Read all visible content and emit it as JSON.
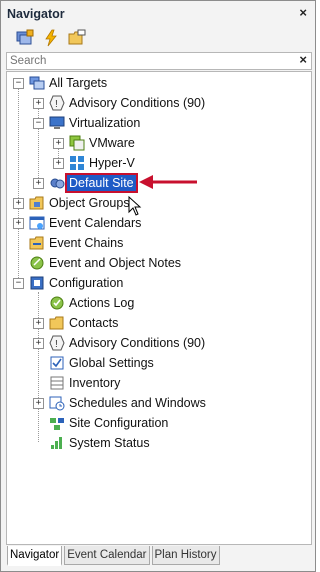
{
  "panel": {
    "title": "Navigator",
    "close_glyph": "×"
  },
  "toolbar": {
    "buttons": [
      "add-targets-icon",
      "lightning-icon",
      "folder-edit-icon"
    ]
  },
  "search": {
    "placeholder": "Search",
    "clear_glyph": "×"
  },
  "tree": {
    "all_targets": "All Targets",
    "advisory_conditions": "Advisory Conditions (90)",
    "virtualization": "Virtualization",
    "vmware": "VMware",
    "hyperv": "Hyper-V",
    "default_site": "Default Site",
    "object_groups": "Object Groups",
    "event_calendars": "Event Calendars",
    "event_chains": "Event Chains",
    "event_notes": "Event and Object Notes",
    "configuration": "Configuration",
    "actions_log": "Actions Log",
    "contacts": "Contacts",
    "config_advisory": "Advisory Conditions (90)",
    "global_settings": "Global Settings",
    "inventory": "Inventory",
    "schedules": "Schedules and Windows",
    "site_configuration": "Site Configuration",
    "system_status": "System Status"
  },
  "tabs": [
    "Navigator",
    "Event Calendar",
    "Plan History"
  ],
  "colors": {
    "selection": "#1e5bc6",
    "highlight_border": "#c8102e",
    "arrow": "#c8102e"
  }
}
